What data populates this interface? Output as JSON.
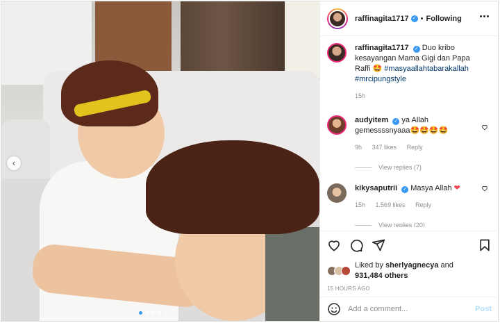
{
  "post": {
    "username": "raffinagita1717",
    "separator": "•",
    "follow_label": "Following",
    "caption_text": "Duo kribo kesayangan Mama Gigi dan Papa Raffi 🤩",
    "caption_tag1": "#masyaallahtabarakallah",
    "caption_tag2": "#mrcipungstyle",
    "caption_time": "15h"
  },
  "comments": [
    {
      "username": "audyitem",
      "text": "ya Allah gemessssnyaaa🤩🤩🤩🤩",
      "time": "9h",
      "likes": "347 likes",
      "reply": "Reply",
      "view_replies": "View replies (7)"
    },
    {
      "username": "kikysaputrii",
      "text": "Masya Allah",
      "heart": "❤",
      "time": "15h",
      "likes": "1.569 likes",
      "reply": "Reply",
      "view_replies": "View replies (20)"
    }
  ],
  "likes_line": {
    "prefix": "Liked by",
    "user": "sherlyagnecya",
    "and": "and",
    "count": "931,484 others"
  },
  "timestamp": "15 HOURS AGO",
  "comment_box": {
    "placeholder": "Add a comment...",
    "post_label": "Post"
  },
  "carousel": {
    "prev_icon": "‹",
    "dot_count": 5,
    "active_index": 0
  },
  "colors": {
    "verified": "#3897f0",
    "hashtag": "#00376b",
    "post_disabled": "#b2dffc"
  },
  "icons": [
    "heart-icon",
    "comment-icon",
    "share-icon",
    "bookmark-icon",
    "emoji-icon",
    "more-icon",
    "verified-icon"
  ]
}
